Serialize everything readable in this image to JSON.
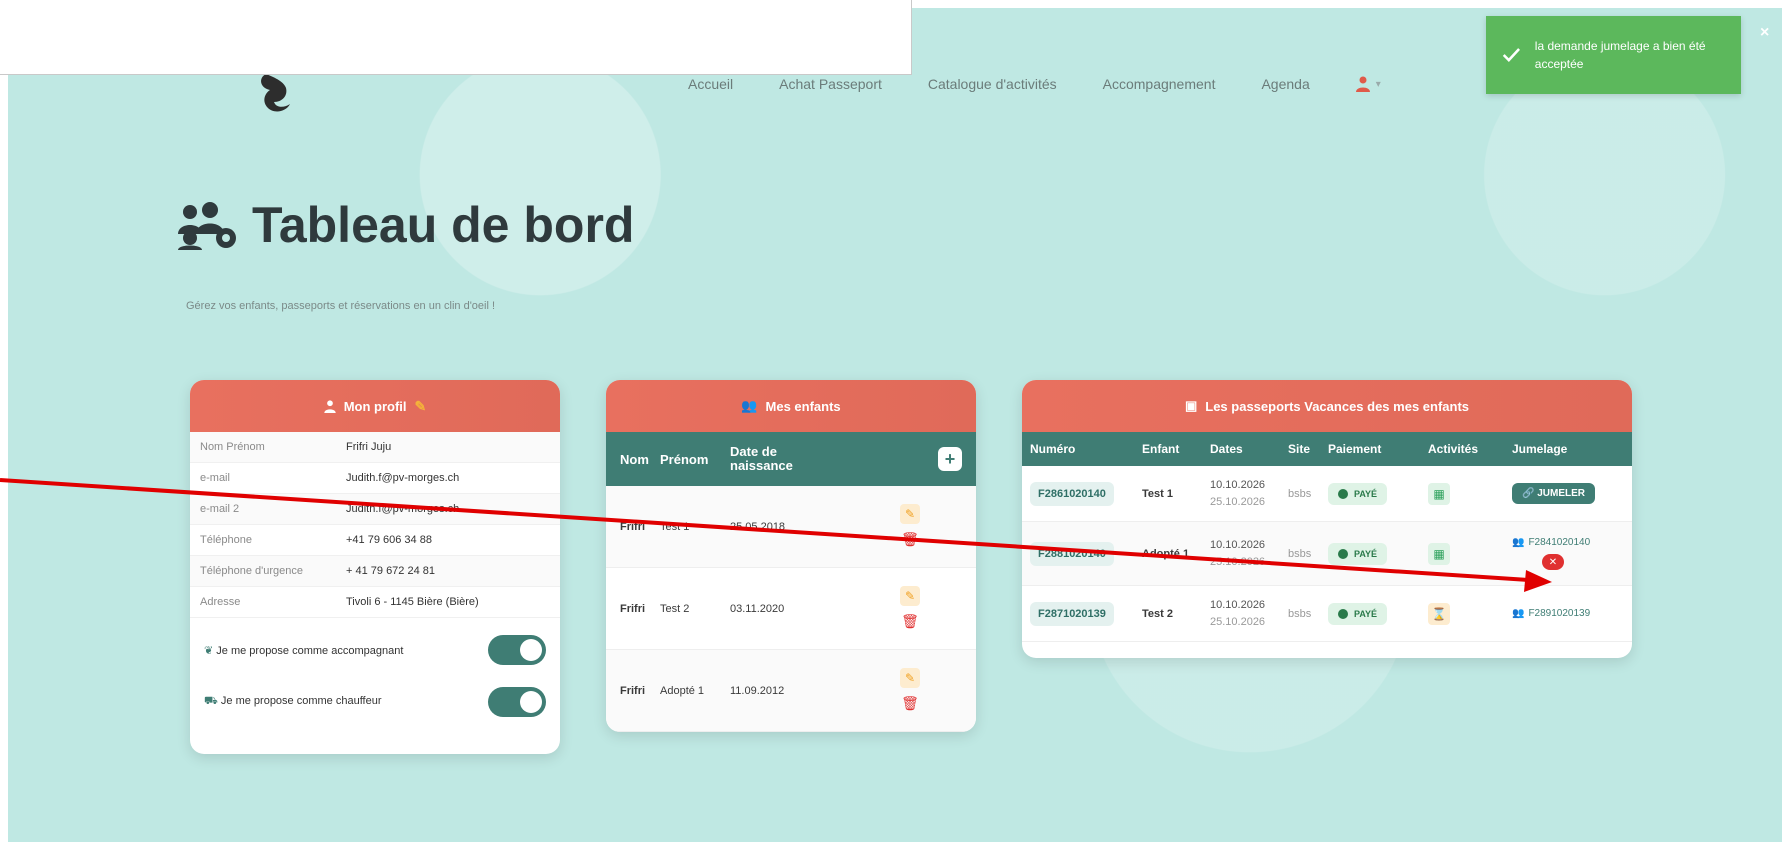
{
  "nav": {
    "items": [
      "Accueil",
      "Achat Passeport",
      "Catalogue d'activités",
      "Accompagnement",
      "Agenda"
    ],
    "user_caret": "▾"
  },
  "toast": {
    "message": "la demande jumelage a bien été acceptée",
    "close": "×",
    "color": "#5cb85c"
  },
  "page": {
    "title": "Tableau de bord",
    "subtitle": "Gérez vos enfants, passeports et réservations en un clin d'oeil !"
  },
  "profile": {
    "header": "Mon profil",
    "rows": [
      {
        "key": "Nom Prénom",
        "value": "Frifri Juju"
      },
      {
        "key": "e-mail",
        "value": "Judith.f@pv-morges.ch"
      },
      {
        "key": "e-mail 2",
        "value": "Judith.f@pv-morges.ch"
      },
      {
        "key": "Téléphone",
        "value": "+41 79 606 34 88"
      },
      {
        "key": "Téléphone d'urgence",
        "value": "+ 41 79 672 24 81"
      },
      {
        "key": "Adresse",
        "value": "Tivoli 6 - 1145 Bière (Bière)"
      }
    ],
    "toggle_accompagnant": "Je me propose comme accompagnant",
    "toggle_chauffeur": "Je me propose comme chauffeur"
  },
  "children": {
    "header": "Mes enfants",
    "columns": [
      "Nom",
      "Prénom",
      "Date de naissance"
    ],
    "add": "+",
    "rows": [
      {
        "nom": "Frifri",
        "prenom": "Test 1",
        "date": "25.05.2018"
      },
      {
        "nom": "Frifri",
        "prenom": "Test 2",
        "date": "03.11.2020"
      },
      {
        "nom": "Frifri",
        "prenom": "Adopté 1",
        "date": "11.09.2012"
      }
    ]
  },
  "passports": {
    "header": "Les passeports Vacances des mes enfants",
    "columns": [
      "Numéro",
      "Enfant",
      "Dates",
      "Site",
      "Paiement",
      "Activités",
      "Jumelage"
    ],
    "rows": [
      {
        "numero": "F2861020140",
        "enfant": "Test 1",
        "date_from": "10.10.2026",
        "date_to": "25.10.2026",
        "site": "bsbs",
        "paiement": "PAYÉ",
        "activite": "calendar-check",
        "jumelage": "JUMELER"
      },
      {
        "numero": "F2881020140",
        "enfant": "Adopté 1",
        "date_from": "10.10.2026",
        "date_to": "25.10.2026",
        "site": "bsbs",
        "paiement": "PAYÉ",
        "activite": "calendar-check",
        "jumelage": "F2841020140",
        "cancel": "✕"
      },
      {
        "numero": "F2871020139",
        "enfant": "Test 2",
        "date_from": "10.10.2026",
        "date_to": "25.10.2026",
        "site": "bsbs",
        "paiement": "PAYÉ",
        "activite": "hourglass",
        "jumelage": "F2891020139"
      }
    ]
  },
  "colors": {
    "accent_header": "#e8705f",
    "table_header": "#3f7d74",
    "background": "#bfe8e3",
    "annotation": "#e00000"
  }
}
